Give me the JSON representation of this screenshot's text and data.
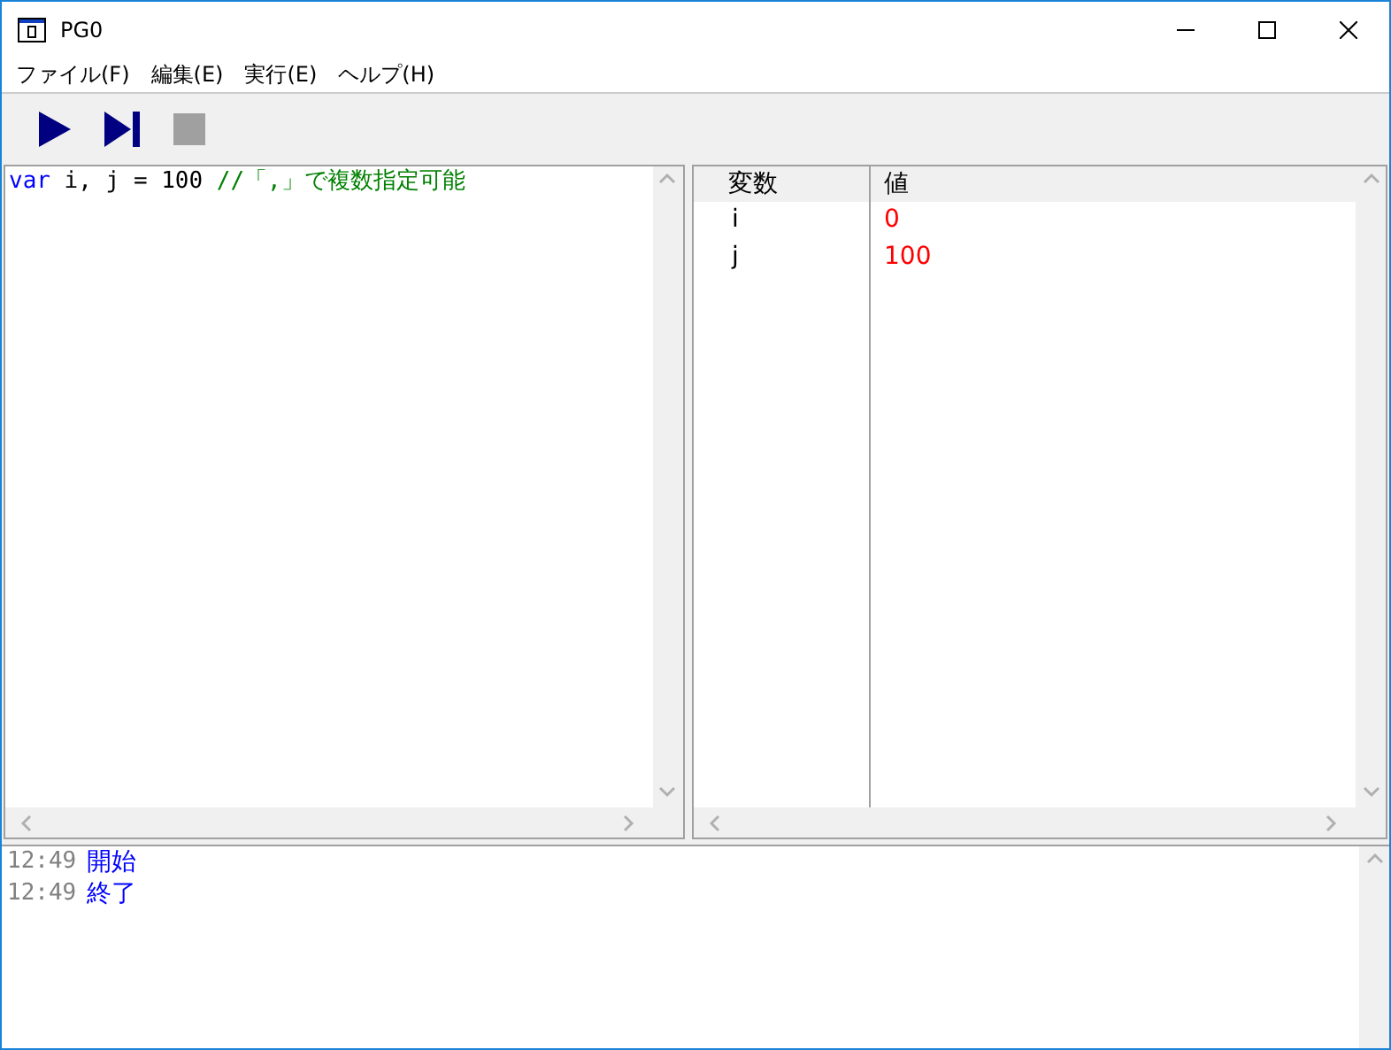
{
  "window": {
    "title": "PG0"
  },
  "menu": [
    "ファイル(F)",
    "編集(E)",
    "実行(E)",
    "ヘルプ(H)"
  ],
  "toolbar": [
    {
      "kind": "run",
      "disabled": false
    },
    {
      "kind": "step",
      "disabled": false
    },
    {
      "kind": "stop",
      "disabled": true
    }
  ],
  "editor": {
    "lines": [
      [
        {
          "kind": "keyword",
          "text": "var"
        },
        {
          "kind": "plain",
          "text": " i, j = 100 "
        },
        {
          "kind": "comment",
          "text": "//「,」で複数指定可能"
        }
      ]
    ]
  },
  "variables": {
    "columns": [
      "変数",
      "値"
    ],
    "rows": [
      [
        "i",
        "0"
      ],
      [
        "j",
        "100"
      ]
    ]
  },
  "log": [
    {
      "time": "12:49",
      "message": "開始"
    },
    {
      "time": "12:49",
      "message": "終了"
    }
  ]
}
